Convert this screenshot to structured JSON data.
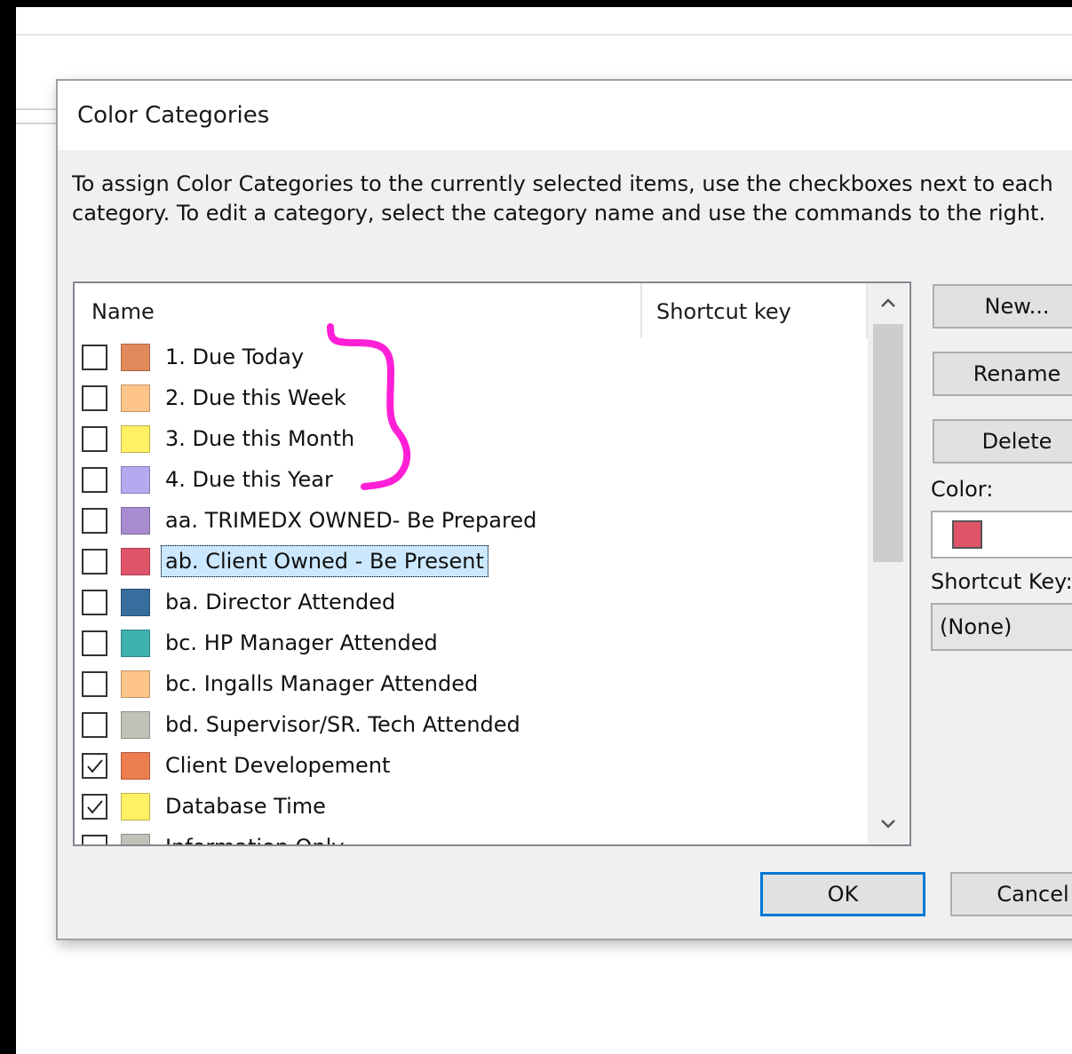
{
  "dialog": {
    "title": "Color Categories",
    "instructions": "To assign Color Categories to the currently selected items, use the checkboxes next to each category.  To edit a category, select the category name and use the commands to the right."
  },
  "list": {
    "columns": {
      "name": "Name",
      "shortcut": "Shortcut key"
    },
    "scroll_up_glyph": "^",
    "scroll_down_glyph": "v",
    "categories": [
      {
        "name": "1. Due Today",
        "color": "#e08a5c",
        "checked": false,
        "selected": false
      },
      {
        "name": "2. Due this Week",
        "color": "#ffc489",
        "checked": false,
        "selected": false
      },
      {
        "name": "3. Due this Month",
        "color": "#fff064",
        "checked": false,
        "selected": false
      },
      {
        "name": "4. Due this Year",
        "color": "#b3aaf0",
        "checked": false,
        "selected": false
      },
      {
        "name": "aa.  TRIMEDX OWNED- Be Prepared",
        "color": "#a98ccf",
        "checked": false,
        "selected": false
      },
      {
        "name": "ab.  Client Owned - Be Present",
        "color": "#e0546a",
        "checked": false,
        "selected": true
      },
      {
        "name": "ba.  Director Attended",
        "color": "#386e9d",
        "checked": false,
        "selected": false
      },
      {
        "name": "bc. HP Manager Attended",
        "color": "#3db2b0",
        "checked": false,
        "selected": false
      },
      {
        "name": "bc. Ingalls Manager Attended",
        "color": "#ffc489",
        "checked": false,
        "selected": false
      },
      {
        "name": "bd. Supervisor/SR. Tech Attended",
        "color": "#c1c1b8",
        "checked": false,
        "selected": false
      },
      {
        "name": "Client Developement",
        "color": "#eb7d4f",
        "checked": true,
        "selected": false
      },
      {
        "name": "Database Time",
        "color": "#fff064",
        "checked": true,
        "selected": false
      },
      {
        "name": "Information Only",
        "color": "#c1c1b8",
        "checked": false,
        "selected": false
      }
    ]
  },
  "side": {
    "new_label": "New...",
    "rename_label": "Rename",
    "delete_label": "Delete",
    "color_label": "Color:",
    "selected_color": "#e0546a",
    "shortcut_label": "Shortcut Key:",
    "shortcut_value": "(None)"
  },
  "footer": {
    "ok_label": "OK",
    "cancel_label": "Cancel"
  },
  "annotation": {
    "color": "#ff1fd6"
  }
}
